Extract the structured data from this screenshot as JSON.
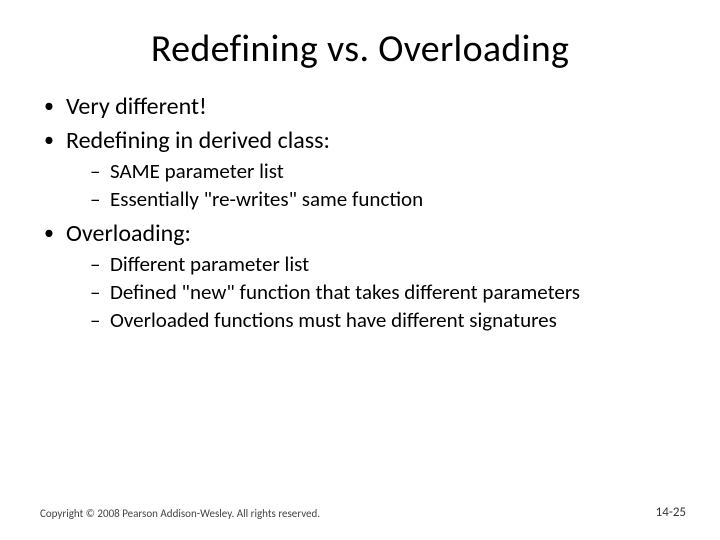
{
  "title": "Redefining vs. Overloading",
  "bullets": [
    {
      "text": "Very different!"
    },
    {
      "text": "Redefining in derived class:",
      "sub": [
        "SAME parameter list",
        "Essentially \"re-writes\" same function"
      ]
    },
    {
      "text": "Overloading:",
      "sub": [
        "Different parameter list",
        "Defined \"new\" function that takes different parameters",
        "Overloaded functions must have different signatures"
      ]
    }
  ],
  "footer": {
    "copyright": "Copyright © 2008 Pearson Addison-Wesley. All rights reserved.",
    "page": "14-25"
  }
}
